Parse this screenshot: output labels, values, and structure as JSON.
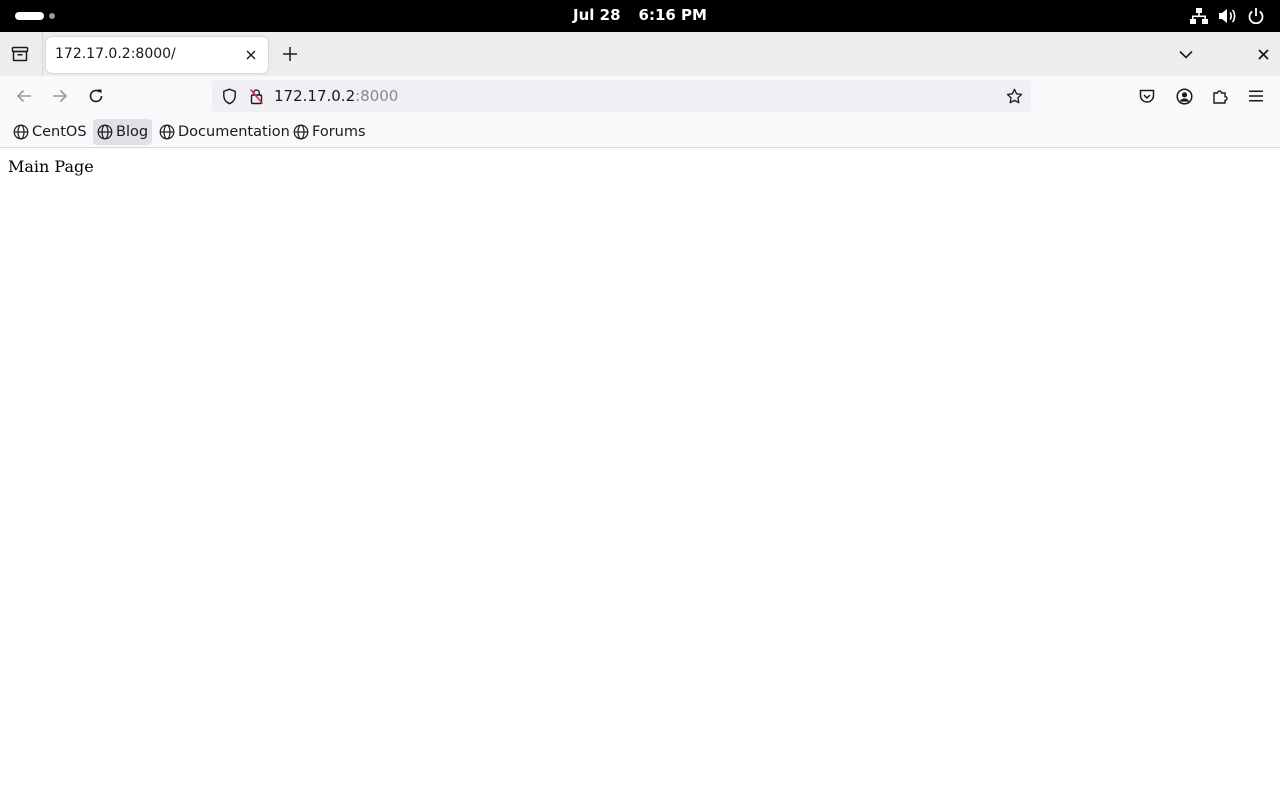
{
  "system_bar": {
    "date": "Jul 28",
    "time": "6:16 PM",
    "tray_icons": [
      "network-icon",
      "volume-icon",
      "power-icon"
    ]
  },
  "browser": {
    "tab": {
      "title": "172.17.0.2:8000/"
    },
    "address": {
      "host": "172.17.0.2",
      "port": ":8000"
    },
    "bookmarks": [
      {
        "label": "CentOS"
      },
      {
        "label": "Blog"
      },
      {
        "label": "Documentation"
      },
      {
        "label": "Forums"
      }
    ]
  },
  "page": {
    "heading": "Main Page"
  },
  "colors": {
    "system_bar": "#000000",
    "tabstrip": "#ededef",
    "toolbar": "#f9f9fb",
    "urlbar": "#f0f0f4"
  }
}
